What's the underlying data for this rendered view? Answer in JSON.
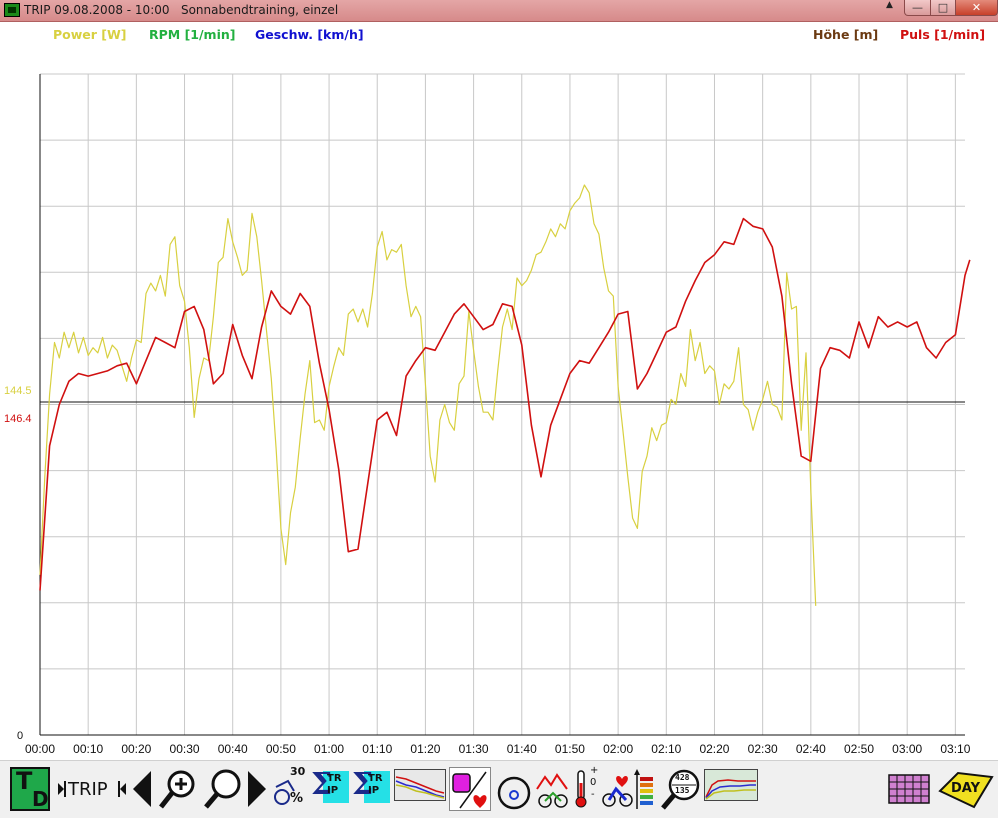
{
  "window": {
    "title": "TRIP 09.08.2008 - 10:00   Sonnabendtraining, einzel",
    "min_glyph": "—",
    "max_glyph": "□",
    "close_glyph": "✕",
    "scroll_glyph": "▲"
  },
  "legend": {
    "power": {
      "label": "Power [W]",
      "color": "#d8d040"
    },
    "rpm": {
      "label": "RPM [1/min]",
      "color": "#22b040"
    },
    "speed": {
      "label": "Geschw. [km/h]",
      "color": "#1010d0"
    },
    "altitude": {
      "label": "Höhe [m]",
      "color": "#6b3a12"
    },
    "pulse": {
      "label": "Puls [1/min]",
      "color": "#d01010"
    }
  },
  "markers": {
    "power_avg": "144.5",
    "pulse_avg": "146.4",
    "y_zero": "0"
  },
  "toolbar": {
    "td_label_t": "T",
    "td_label_d": "D",
    "trip_label": "TRIP",
    "speed_top": "30",
    "speed_pct": "%",
    "sum_trip_1": "TR IP",
    "sum_trip_2": "TR IP",
    "sigma": "Σ",
    "thermo_plus": "+",
    "thermo_zero": "0",
    "thermo_minus": "-",
    "gauge_top": "428",
    "gauge_bottom": "135",
    "day_label": "DAY"
  },
  "chart_data": {
    "type": "line",
    "x_unit": "time h:mm",
    "x_tick_labels": [
      "00:00",
      "00:10",
      "00:20",
      "00:30",
      "00:40",
      "00:50",
      "01:00",
      "01:10",
      "01:20",
      "01:30",
      "01:40",
      "01:50",
      "02:00",
      "02:10",
      "02:20",
      "02:30",
      "02:40",
      "02:50",
      "03:00",
      "03:10"
    ],
    "xlim_min": [
      0,
      193
    ],
    "reference_lines": [
      {
        "series": "Power",
        "value": 144.5
      },
      {
        "series": "Puls",
        "value": 146.4
      }
    ],
    "grid": true,
    "series": [
      {
        "name": "Power [W]",
        "color": "#d8d040",
        "x_min": [
          0,
          1,
          2,
          3,
          4,
          5,
          6,
          7,
          8,
          9,
          10,
          11,
          12,
          13,
          14,
          15,
          16,
          17,
          18,
          19,
          20,
          21,
          22,
          23,
          24,
          25,
          26,
          27,
          28,
          29,
          30,
          31,
          32,
          33,
          34,
          35,
          36,
          37,
          38,
          39,
          40,
          41,
          42,
          43,
          44,
          45,
          46,
          47,
          48,
          49,
          50,
          51,
          52,
          53,
          54,
          55,
          56,
          57,
          58,
          59,
          60,
          61,
          62,
          63,
          64,
          65,
          66,
          67,
          68,
          69,
          70,
          71,
          72,
          73,
          74,
          75,
          76,
          77,
          78,
          79,
          80,
          81,
          82,
          83,
          84,
          85,
          86,
          87,
          88,
          89,
          90,
          91,
          92,
          93,
          94,
          95,
          96,
          97,
          98,
          99,
          100,
          101,
          102,
          103,
          104,
          105,
          106,
          107,
          108,
          109,
          110,
          111,
          112,
          113,
          114,
          115,
          116,
          117,
          118,
          119,
          120,
          121,
          122,
          123,
          124,
          125,
          126,
          127,
          128,
          129,
          130,
          131,
          132,
          133,
          134,
          135,
          136,
          137,
          138,
          139,
          140,
          141,
          142,
          143,
          144,
          145,
          146,
          147,
          148,
          149,
          150,
          151,
          152,
          153,
          154,
          155,
          156,
          157,
          158,
          159,
          160,
          161,
          162,
          163,
          164,
          165,
          166,
          167,
          168,
          169,
          170,
          171,
          172,
          173,
          174,
          175,
          176,
          177,
          178,
          179,
          180,
          181,
          182,
          183,
          184,
          185,
          186,
          187,
          188,
          189,
          190,
          191,
          192,
          193
        ],
        "values": [
          62,
          100,
          132,
          152,
          146,
          156,
          150,
          156,
          148,
          154,
          147,
          150,
          148,
          154,
          146,
          151,
          149,
          143,
          137,
          146,
          153,
          152,
          171,
          175,
          172,
          178,
          170,
          190,
          193,
          174,
          168,
          150,
          123,
          138,
          146,
          145,
          162,
          183,
          185,
          200,
          191,
          185,
          178,
          180,
          202,
          193,
          176,
          157,
          138,
          111,
          80,
          66,
          86,
          96,
          115,
          132,
          145,
          121,
          122,
          118,
          135,
          143,
          150,
          147,
          163,
          165,
          160,
          165,
          158,
          171,
          189,
          195,
          184,
          188,
          187,
          190,
          174,
          162,
          166,
          162,
          136,
          108,
          98,
          122,
          128,
          121,
          118,
          136,
          139,
          164,
          149,
          135,
          125,
          125,
          122,
          141,
          158,
          165,
          157,
          177,
          174,
          176,
          180,
          186,
          187,
          191,
          196,
          193,
          198,
          196,
          203,
          206,
          208,
          213,
          210,
          198,
          194,
          181,
          172,
          170,
          135,
          118,
          100,
          84,
          80,
          102,
          108,
          119,
          114,
          120,
          121,
          130,
          128,
          140,
          135,
          157,
          145,
          152,
          140,
          143,
          141,
          128,
          136,
          134,
          137,
          150,
          128,
          126,
          118,
          125,
          130,
          137,
          128,
          127,
          122,
          179,
          165,
          166,
          118,
          148,
          95,
          50
        ]
      },
      {
        "name": "Puls [1/min]",
        "color": "#d01010",
        "x_min": [
          0,
          2,
          4,
          6,
          8,
          10,
          12,
          14,
          16,
          18,
          20,
          22,
          24,
          26,
          28,
          30,
          32,
          34,
          36,
          38,
          40,
          42,
          44,
          46,
          48,
          50,
          52,
          54,
          56,
          58,
          60,
          62,
          64,
          66,
          68,
          70,
          72,
          74,
          76,
          78,
          80,
          82,
          84,
          86,
          88,
          90,
          92,
          94,
          96,
          98,
          100,
          102,
          104,
          106,
          108,
          110,
          112,
          114,
          116,
          118,
          120,
          122,
          124,
          126,
          128,
          130,
          132,
          134,
          136,
          138,
          140,
          142,
          144,
          146,
          148,
          150,
          152,
          154,
          156,
          158,
          160,
          162,
          164,
          166,
          168,
          170,
          172,
          174,
          176,
          178,
          180,
          182,
          184,
          186,
          188,
          190,
          192,
          193
        ],
        "values": [
          56,
          112,
          128,
          137,
          140,
          139,
          140,
          141,
          143,
          144,
          136,
          145,
          154,
          152,
          150,
          164,
          166,
          157,
          136,
          140,
          159,
          147,
          138,
          158,
          172,
          166,
          163,
          171,
          166,
          144,
          126,
          103,
          71,
          72,
          97,
          122,
          125,
          116,
          139,
          145,
          150,
          149,
          156,
          163,
          167,
          162,
          157,
          159,
          167,
          166,
          151,
          120,
          100,
          120,
          130,
          140,
          145,
          144,
          150,
          156,
          163,
          164,
          134,
          140,
          148,
          156,
          158,
          168,
          176,
          183,
          186,
          191,
          190,
          200,
          197,
          196,
          189,
          170,
          136,
          108,
          106,
          142,
          150,
          149,
          146,
          160,
          150,
          162,
          158,
          160,
          158,
          160,
          150,
          146,
          152,
          155,
          178,
          184
        ]
      }
    ]
  }
}
